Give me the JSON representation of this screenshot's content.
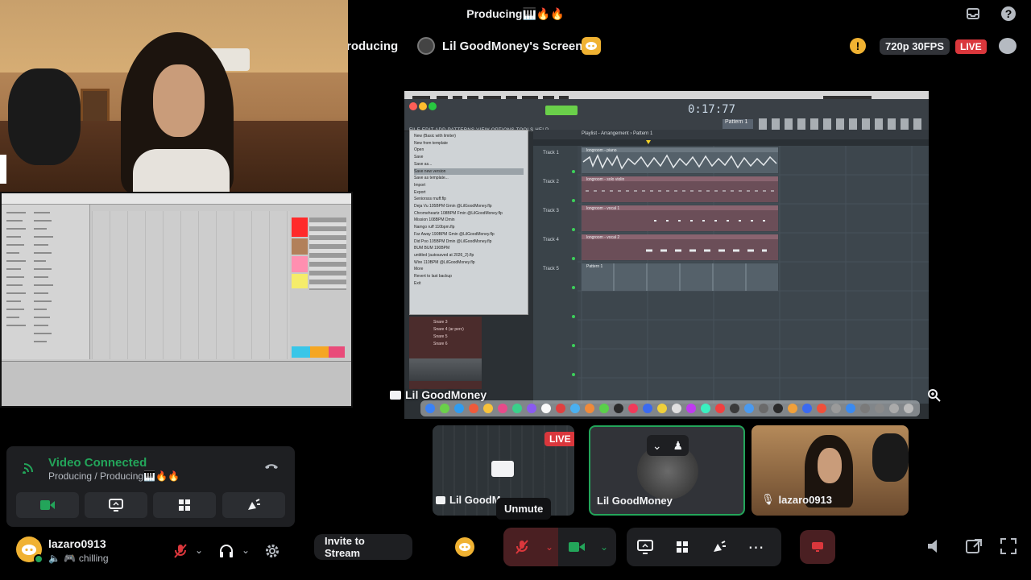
{
  "window": {
    "title": "Producing🎹🔥🔥"
  },
  "header": {
    "channel_partial": "roducing",
    "screen_title": "Lil GoodMoney's Screen",
    "quality": "720p 30FPS",
    "live": "LIVE"
  },
  "main_stream": {
    "streamer_label": "Lil GoodMoney",
    "daw": {
      "app_menu": [
        "FL Studio",
        "File",
        "Edit",
        "Add",
        "Patterns",
        "View",
        "Options",
        "Tools",
        "Help"
      ],
      "time_display": "0:17:77",
      "pattern": "Pattern 1",
      "playlist_title": "Playlist - Arrangement › Pattern 1",
      "menu_bar": "FILE  EDIT  ADD  PATTERNS  VIEW  OPTIONS  TOOLS  HELP",
      "file_menu": [
        "New (Basic with limiter)",
        "New from template",
        "Open",
        "Save",
        "Save as...",
        "Save new version",
        "Save as template...",
        "Import",
        "Export",
        "Seniorsss rnuff.flp",
        "Deja Vu 105BPM Gmin @LilGoodMoney.flp",
        "Chromeheartz 108BPM Fmin @LilGoodMoney.flp",
        "Mission 108BPM Dmin",
        "Namgo ruff 110bpm.flp",
        "Far Away 190BPM Gmin @LilGoodMoney.flp",
        "Did Poo 105BPM Dmin @LilGoodMoney.flp",
        "BUM BUM 190BPM",
        "untitled (autosaved at 2026_2).flp",
        "Wire 110BPM @LilGoodMoney.flp",
        "More",
        "Revert to last backup",
        "Exit"
      ],
      "tracks": [
        "Track 1",
        "Track 2",
        "Track 3",
        "Track 4",
        "Track 5"
      ],
      "clips": [
        "longroom - piano",
        "longroom - solo violin",
        "longroom - vocal 1",
        "longroom - vocal 2",
        "Pattern 1"
      ],
      "browser_items": [
        "Snare 3",
        "Snare 4 (ar perc)",
        "Snare 5",
        "Snare 6"
      ]
    }
  },
  "thumbnails": [
    {
      "label": "Lil GoodM",
      "badge": "LIVE"
    },
    {
      "label": "Lil GoodMoney"
    },
    {
      "label": "lazaro0913"
    }
  ],
  "tooltip": "Unmute",
  "voice_panel": {
    "status": "Video Connected",
    "location": "Producing / Producing🎹🔥🔥"
  },
  "user": {
    "name": "lazaro0913",
    "status": "chilling"
  },
  "controls": {
    "invite": "Invite to Stream"
  },
  "colors": {
    "green": "#23a55a",
    "red": "#da373c",
    "blurple": "#5865f2",
    "yellow": "#f0b232"
  }
}
